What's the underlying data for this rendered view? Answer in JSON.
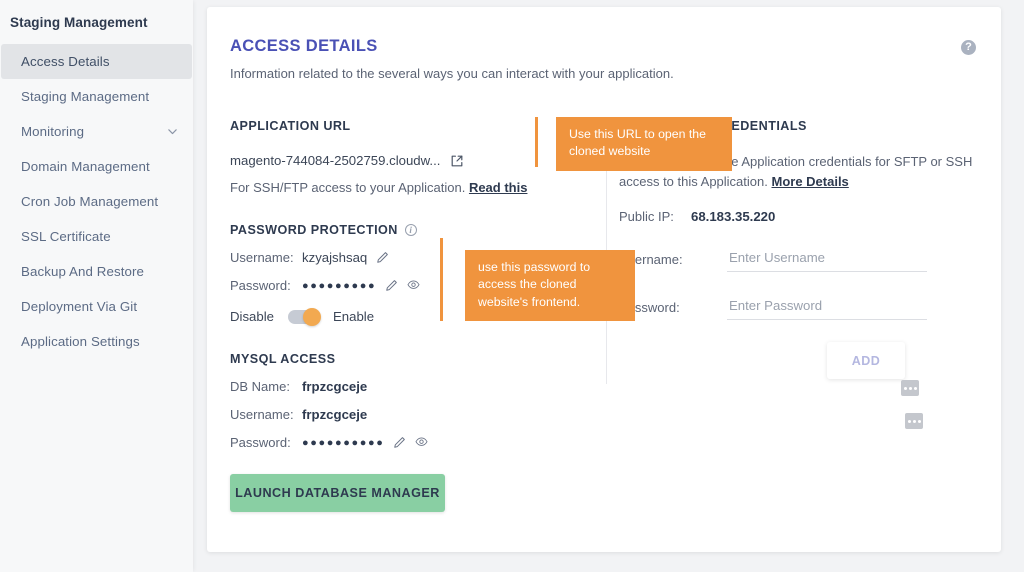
{
  "sidebar": {
    "title": "Staging Management",
    "items": [
      {
        "label": "Access Details",
        "active": true,
        "chevron": false
      },
      {
        "label": "Staging Management",
        "active": false,
        "chevron": false
      },
      {
        "label": "Monitoring",
        "active": false,
        "chevron": true
      },
      {
        "label": "Domain Management",
        "active": false,
        "chevron": false
      },
      {
        "label": "Cron Job Management",
        "active": false,
        "chevron": false
      },
      {
        "label": "SSL Certificate",
        "active": false,
        "chevron": false
      },
      {
        "label": "Backup And Restore",
        "active": false,
        "chevron": false
      },
      {
        "label": "Deployment Via Git",
        "active": false,
        "chevron": false
      },
      {
        "label": "Application Settings",
        "active": false,
        "chevron": false
      }
    ]
  },
  "header": {
    "title": "ACCESS DETAILS",
    "subtitle": "Information related to the several ways you can interact with your application.",
    "help_label": "?"
  },
  "application_url": {
    "heading": "APPLICATION URL",
    "url": "magento-744084-2502759.cloudw...",
    "ssh_text": "For SSH/FTP access to your Application.",
    "ssh_link": "Read this"
  },
  "password_protection": {
    "heading": "PASSWORD PROTECTION",
    "info_label": "i",
    "username_label": "Username:",
    "username_value": "kzyajshsaq",
    "password_label": "Password:",
    "password_masked": "●●●●●●●●●",
    "toggle_off_label": "Disable",
    "toggle_on_label": "Enable",
    "toggle_state": "enabled"
  },
  "mysql_access": {
    "heading": "MYSQL ACCESS",
    "db_name_label": "DB Name:",
    "db_name_value": "frpzcgceje",
    "username_label": "Username:",
    "username_value": "frpzcgceje",
    "password_label": "Password:",
    "password_masked": "●●●●●●●●●●"
  },
  "launch_button": {
    "label": "LAUNCH DATABASE MANAGER"
  },
  "application_credentials": {
    "heading": "APPLICATION CREDENTIALS",
    "description": "You can use multiple Application credentials for SFTP or SSH access to this Application.",
    "more_link": "More Details",
    "public_ip_label": "Public IP:",
    "public_ip_value": "68.183.35.220",
    "username_label": "Username:",
    "username_placeholder": "Enter Username",
    "username_value": "",
    "password_label": "Password:",
    "password_placeholder": "Enter Password",
    "password_value": "",
    "add_button_label": "ADD"
  },
  "callouts": {
    "url_tip": "Use this URL to open the cloned website",
    "password_tip": "use this password to access the cloned website's frontend."
  },
  "colors": {
    "accent_purple": "#4a51b5",
    "tooltip_orange": "#f0943e",
    "toggle_orange": "#f2a950",
    "launch_green": "#89cfa3",
    "page_bg": "#f2f3f5"
  }
}
